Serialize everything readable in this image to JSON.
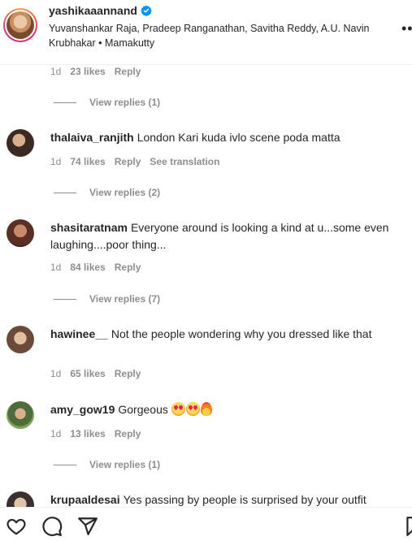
{
  "header": {
    "username": "yashikaaannand",
    "tagged": "Yuvanshankar Raja, Pradeep Ranganathan, Savitha Reddy, A.U. Navin Krubhakar • Mamakutty",
    "more": "••"
  },
  "comments": [
    {
      "time": "1d",
      "likes": "23 likes",
      "reply": "Reply",
      "view_replies": "View replies (1)"
    },
    {
      "user": "thalaiva_ranjith",
      "text": "London Kari kuda ivlo scene poda matta",
      "time": "1d",
      "likes": "74 likes",
      "reply": "Reply",
      "translate": "See translation",
      "view_replies": "View replies (2)"
    },
    {
      "user": "shasitaratnam",
      "text": "Everyone around is looking a kind at u...some even laughing....poor thing...",
      "time": "1d",
      "likes": "84 likes",
      "reply": "Reply",
      "view_replies": "View replies (7)"
    },
    {
      "user": "hawinee__",
      "text": "Not the people wondering why you dressed like that",
      "time": "1d",
      "likes": "65 likes",
      "reply": "Reply"
    },
    {
      "user": "amy_gow19",
      "text": "Gorgeous",
      "time": "1d",
      "likes": "13 likes",
      "reply": "Reply",
      "view_replies": "View replies (1)"
    },
    {
      "user": "krupaaldesai",
      "text": "Yes passing by people is surprised by your outfit"
    }
  ],
  "colors": {
    "accent": "#0095f6",
    "muted": "#8e8e8e",
    "text": "#262626"
  }
}
